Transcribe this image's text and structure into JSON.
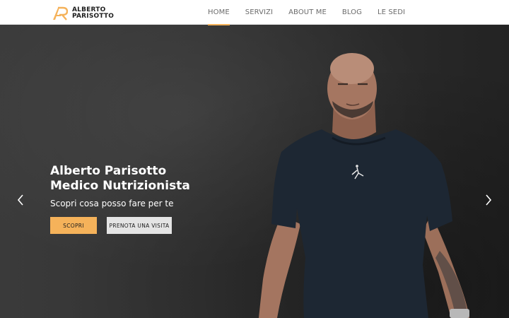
{
  "brand": {
    "name_line1": "ALBERTO",
    "name_line2": "PARISOTTO",
    "accent_color": "#f5b25a"
  },
  "nav": {
    "items": [
      {
        "label": "HOME",
        "active": true
      },
      {
        "label": "SERVIZI",
        "active": false
      },
      {
        "label": "ABOUT ME",
        "active": false
      },
      {
        "label": "BLOG",
        "active": false
      },
      {
        "label": "LE SEDI",
        "active": false
      }
    ]
  },
  "hero": {
    "title_line1": "Alberto Parisotto",
    "title_line2": "Medico Nutrizionista",
    "subtitle": "Scopri cosa posso fare per te",
    "primary_button": "SCOPRI",
    "secondary_button": "PRENOTA UNA VISITA",
    "prev_icon": "chevron-left-icon",
    "next_icon": "chevron-right-icon"
  }
}
